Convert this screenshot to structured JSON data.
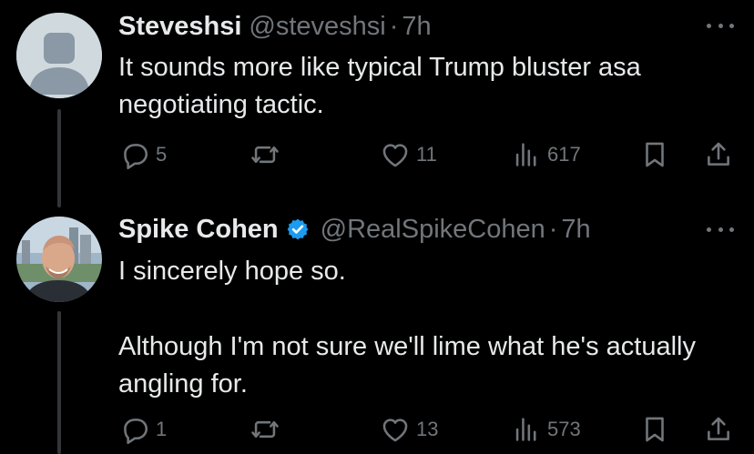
{
  "colors": {
    "background": "#000000",
    "primary_text": "#e7e9ea",
    "secondary_text": "#71767b",
    "verified_badge": "#1d9bf0",
    "thread_line": "#333639"
  },
  "tweets": [
    {
      "display_name": "Steveshsi",
      "handle": "@steveshsi",
      "separator": "·",
      "time": "7h",
      "verified": false,
      "avatar": "default-avatar-placeholder",
      "paragraphs": [
        "It sounds more like typical Trump bluster asa negotiating tactic."
      ],
      "actions": {
        "replies": "5",
        "reposts": "",
        "likes": "11",
        "views": "617"
      }
    },
    {
      "display_name": "Spike Cohen",
      "handle": "@RealSpikeCohen",
      "separator": "·",
      "time": "7h",
      "verified": true,
      "avatar": "profile-photo",
      "paragraphs": [
        "I sincerely hope so.",
        "Although I'm not sure we'll lime what he's actually angling for."
      ],
      "actions": {
        "replies": "1",
        "reposts": "",
        "likes": "13",
        "views": "573"
      }
    }
  ],
  "icons": {
    "reply": "reply-bubble-icon",
    "repost": "repost-arrows-icon",
    "like": "heart-icon",
    "views": "bar-chart-icon",
    "bookmark": "bookmark-icon",
    "share": "share-upload-icon",
    "more": "more-dots-icon",
    "verified": "verified-badge-icon"
  }
}
